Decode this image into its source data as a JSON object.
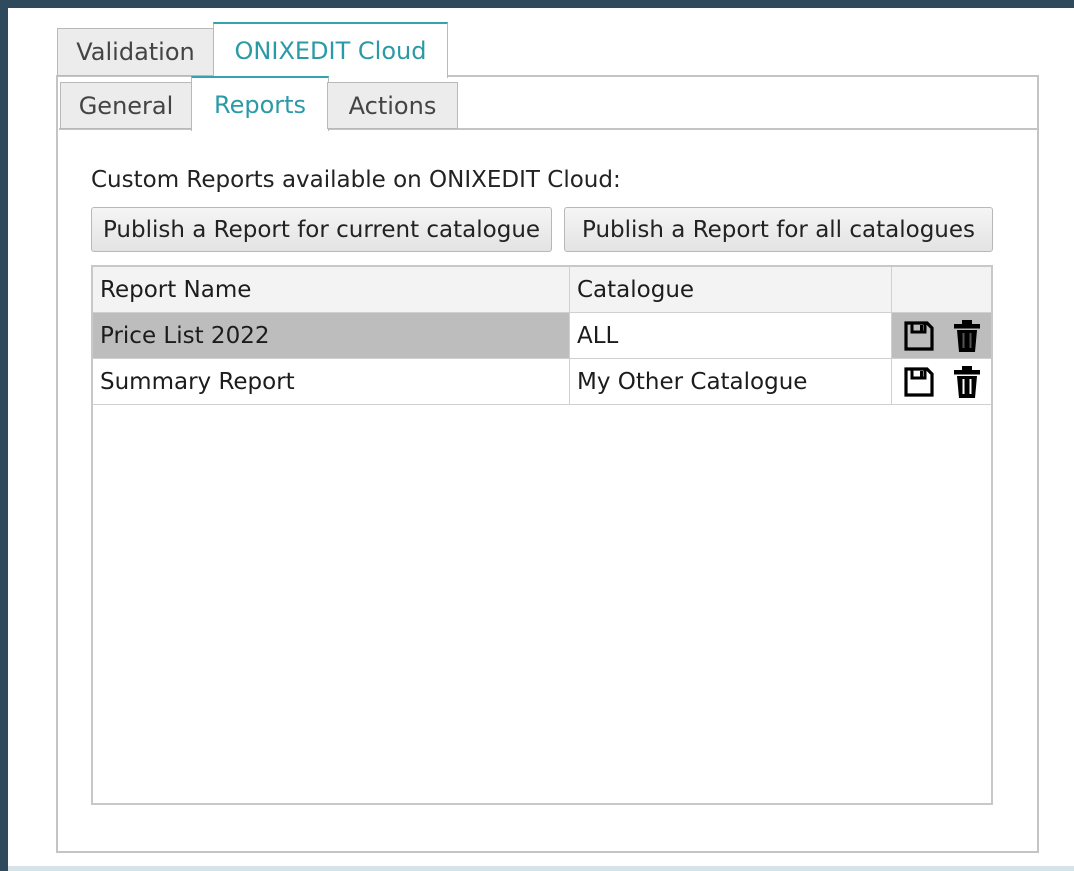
{
  "top_tabs": [
    {
      "label": "Validation",
      "active": false
    },
    {
      "label": "ONIXEDIT Cloud",
      "active": true
    }
  ],
  "sub_tabs": [
    {
      "label": "General",
      "active": false
    },
    {
      "label": "Reports",
      "active": true
    },
    {
      "label": "Actions",
      "active": false
    }
  ],
  "reports": {
    "caption": "Custom Reports available on ONIXEDIT Cloud:",
    "publish_current_label": "Publish a Report for current catalogue",
    "publish_all_label": "Publish a Report for all catalogues",
    "table": {
      "columns": [
        "Report Name",
        "Catalogue",
        ""
      ],
      "rows": [
        {
          "name": "Price List 2022",
          "catalogue": "ALL",
          "selected": true,
          "actions": [
            "save-icon",
            "trash-icon"
          ]
        },
        {
          "name": "Summary Report",
          "catalogue": "My Other Catalogue",
          "selected": false,
          "actions": [
            "save-icon",
            "trash-icon"
          ]
        }
      ]
    }
  },
  "colors": {
    "accent": "#34a3ad",
    "window_frame": "#2e4a5c",
    "selected_row": "#bdbdbd"
  }
}
